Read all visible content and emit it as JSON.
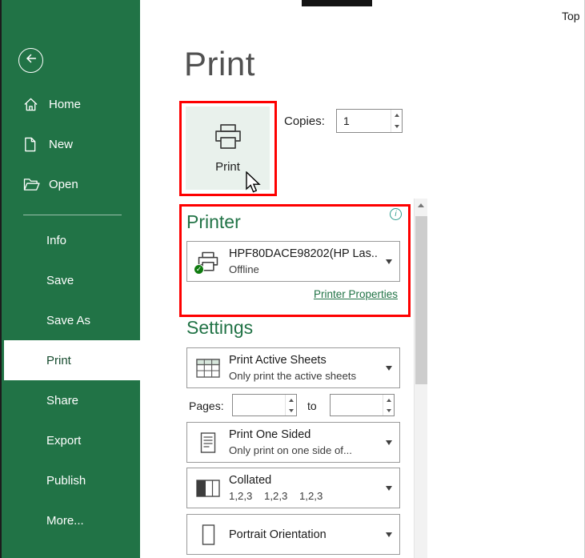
{
  "top": {
    "label": "Top"
  },
  "icons": {
    "info": "i",
    "check": "✓"
  },
  "sidebar": {
    "top_items": [
      {
        "label": "Home"
      },
      {
        "label": "New"
      },
      {
        "label": "Open"
      }
    ],
    "bottom_items": [
      {
        "label": "Info"
      },
      {
        "label": "Save"
      },
      {
        "label": "Save As"
      },
      {
        "label": "Print"
      },
      {
        "label": "Share"
      },
      {
        "label": "Export"
      },
      {
        "label": "Publish"
      },
      {
        "label": "More..."
      }
    ]
  },
  "main": {
    "title": "Print",
    "print_button": {
      "label": "Print"
    },
    "copies": {
      "label": "Copies:",
      "value": "1"
    },
    "printer": {
      "heading": "Printer",
      "name": "HPF80DACE98202(HP Las...",
      "status": "Offline",
      "properties_link": "Printer Properties"
    },
    "settings": {
      "heading": "Settings",
      "sheets": {
        "title": "Print Active Sheets",
        "subtitle": "Only print the active sheets"
      },
      "pages": {
        "label": "Pages:",
        "to": "to",
        "from_value": "",
        "to_value": ""
      },
      "sided": {
        "title": "Print One Sided",
        "subtitle": "Only print on one side of..."
      },
      "collated": {
        "title": "Collated",
        "subtitle": "1,2,3    1,2,3    1,2,3"
      },
      "orientation": {
        "title": "Portrait Orientation"
      }
    }
  },
  "colors": {
    "sidebar_green": "#217346",
    "accent_green": "#217346",
    "annotation_red": "#fe0000",
    "printer_check_green": "#0f7b0f"
  }
}
